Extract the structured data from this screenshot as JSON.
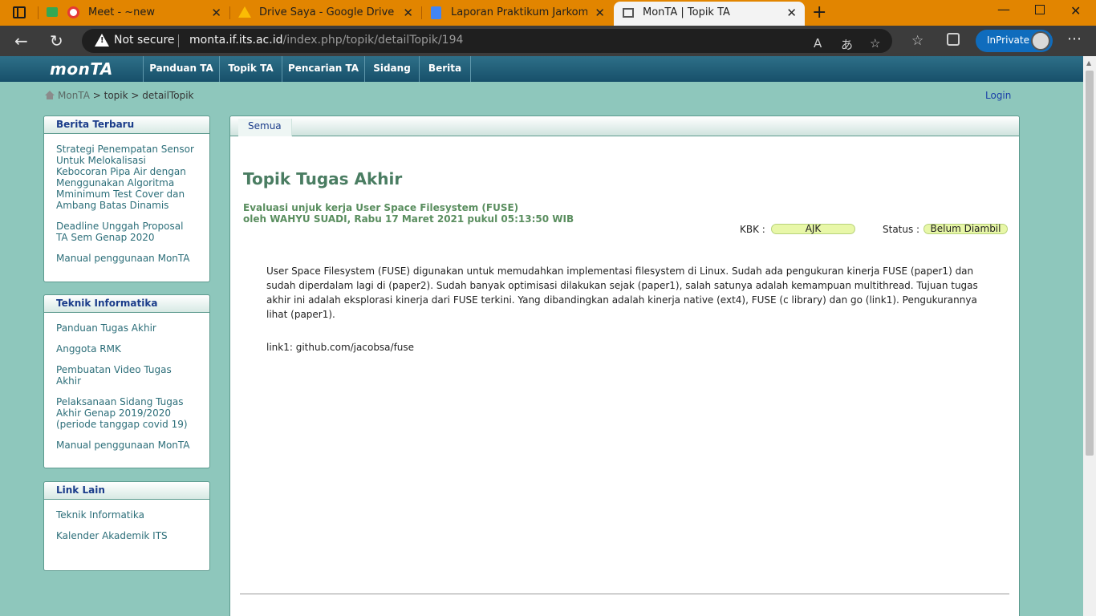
{
  "browser": {
    "tabs": [
      {
        "label": "Meet - ~new"
      },
      {
        "label": "Drive Saya - Google Drive"
      },
      {
        "label": "Laporan Praktikum Jarkom - Goo"
      },
      {
        "label": "MonTA | Topik TA"
      }
    ],
    "address": {
      "security": "Not secure",
      "host": "monta.if.its.ac.id",
      "path": "/index.php/topik/detailTopik/194"
    },
    "profile_label": "InPrivate"
  },
  "site": {
    "logo": "monTA",
    "nav": [
      "Panduan TA",
      "Topik TA",
      "Pencarian TA",
      "Sidang",
      "Berita"
    ],
    "breadcrumb": {
      "home": "MonTA",
      "sep1": " > ",
      "topik": "topik",
      "sep2": " > ",
      "current": "detailTopik"
    },
    "login": "Login"
  },
  "sidebar": {
    "berita": {
      "title": "Berita Terbaru",
      "items": [
        "Strategi Penempatan Sensor Untuk Melokalisasi Kebocoran Pipa Air dengan Menggunakan Algoritma Mminimum Test Cover dan Ambang Batas Dinamis",
        "Deadline Unggah Proposal TA Sem Genap 2020",
        "Manual penggunaan MonTA"
      ]
    },
    "informatika": {
      "title": "Teknik Informatika",
      "items": [
        "Panduan Tugas Akhir",
        "Anggota RMK",
        "Pembuatan Video Tugas Akhir",
        "Pelaksanaan Sidang Tugas Akhir Genap 2019/2020 (periode tanggap covid 19)",
        "Manual penggunaan MonTA"
      ]
    },
    "link_lain": {
      "title": "Link Lain",
      "items": [
        "Teknik Informatika",
        "Kalender Akademik ITS"
      ]
    }
  },
  "main": {
    "tab": "Semua",
    "title": "Topik Tugas Akhir",
    "topic": "Evaluasi unjuk kerja User Space Filesystem (FUSE)",
    "byline": "oleh WAHYU SUADI, Rabu 17 Maret 2021 pukul 05:13:50 WIB",
    "kbk_label": "KBK :",
    "kbk_value": "AJK",
    "status_label": "Status :",
    "status_value": "Belum Diambil",
    "description": "User Space Filesystem (FUSE) digunakan untuk memudahkan implementasi filesystem di Linux. Sudah ada pengukuran kinerja FUSE (paper1) dan sudah diperdalam lagi di (paper2). Sudah banyak optimisasi dilakukan sejak (paper1), salah satunya adalah kemampuan multithread. Tujuan tugas akhir ini adalah eksplorasi kinerja dari FUSE terkini. Yang dibandingkan adalah kinerja native (ext4), FUSE (c library) dan go (link1). Pengukurannya lihat (paper1).",
    "link1": "link1: github.com/jacobsa/fuse"
  }
}
